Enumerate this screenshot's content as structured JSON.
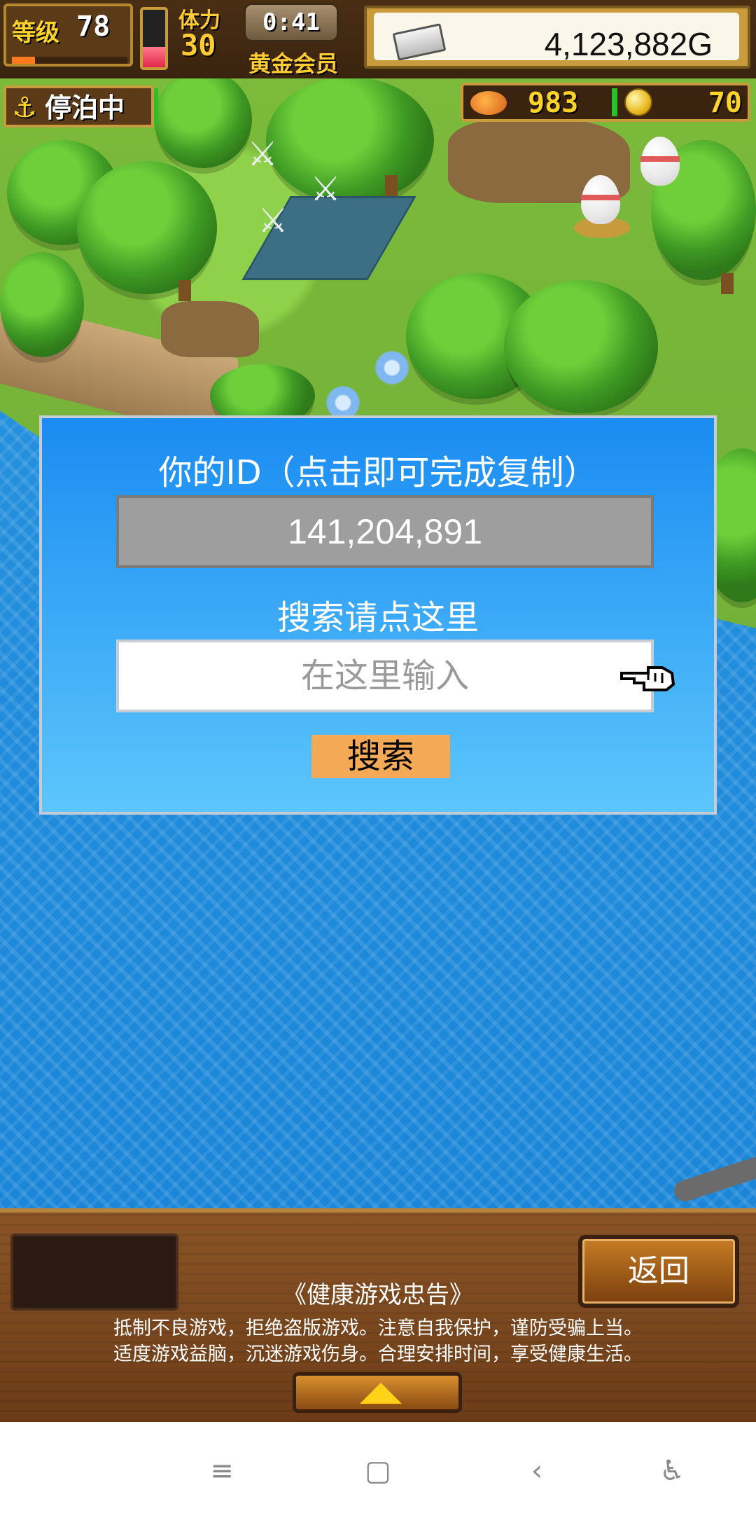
{
  "hud": {
    "level_label": "等级",
    "level": "78",
    "level_progress": 0.2,
    "stamina_label": "体力",
    "stamina": "30",
    "stamina_gauge_fill": 0.35,
    "timer": "0:41",
    "membership": "黄金会员",
    "gold": "4,123,882G",
    "status": "停泊中",
    "fish_count": "983",
    "coin_count": "70"
  },
  "dialog": {
    "id_title": "你的ID（点击即可完成复制）",
    "user_id": "141,204,891",
    "search_title": "搜索请点这里",
    "search_placeholder": "在这里输入",
    "search_button": "搜索"
  },
  "footer": {
    "back_button": "返回",
    "advice_title": "《健康游戏忠告》",
    "advice_line1": "抵制不良游戏，拒绝盗版游戏。注意自我保护，谨防受骗上当。",
    "advice_line2": "适度游戏益脑，沉迷游戏伤身。合理安排时间，享受健康生活。"
  },
  "nav": {
    "menu_icon": "≡",
    "home_icon": "▢",
    "back_icon": "‹",
    "accessibility_icon": "♿"
  },
  "colors": {
    "dialog_top": "#1a8cf2",
    "dialog_bottom": "#5cc6fb",
    "search_button": "#f3a955",
    "gold_text": "#ffd42a"
  }
}
